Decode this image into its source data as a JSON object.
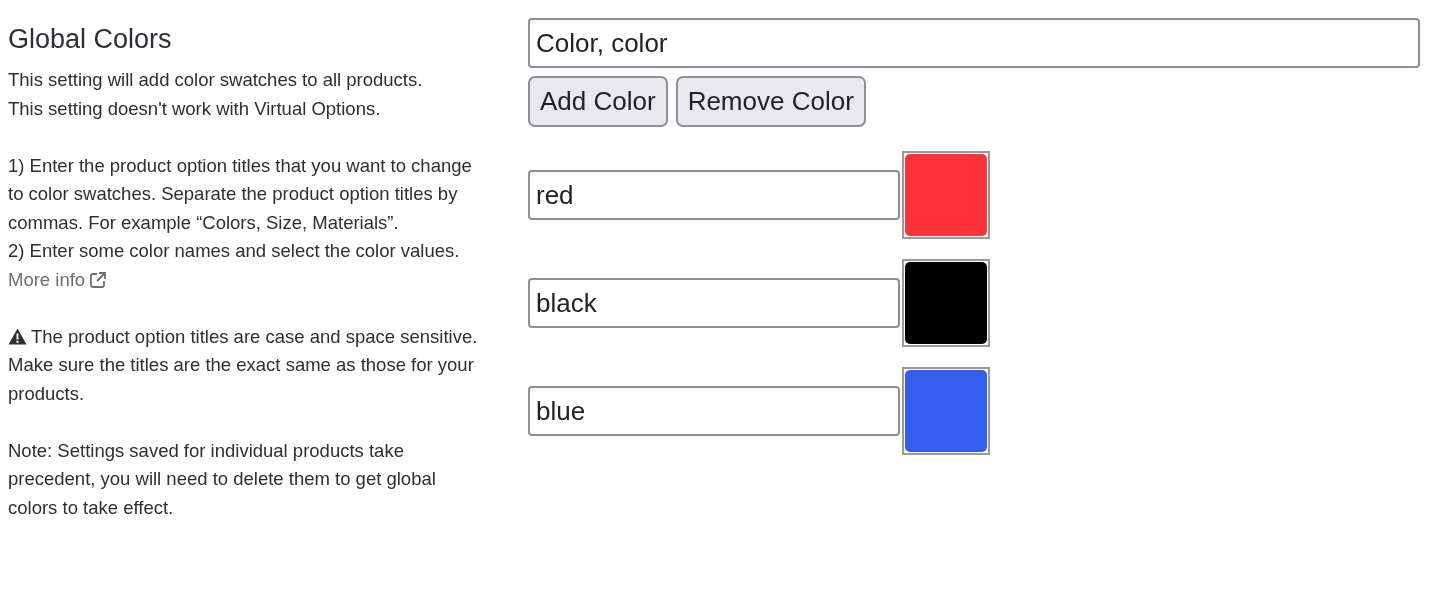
{
  "heading": "Global Colors",
  "intro_lines": [
    "This setting will add color swatches to all products.",
    "This setting doesn't work with Virtual Options."
  ],
  "steps": [
    "1) Enter the product option titles that you want to change to color swatches. Separate the product option titles by commas. For example “Colors, Size, Materials”.",
    "2) Enter some color names and select the color values."
  ],
  "more_info_link": "More info",
  "warning": "The product option titles are case and space sensitive. Make sure the titles are the exact same as those for your products.",
  "note": "Note: Settings saved for individual products take precedent, you will need to delete them to get global colors to take effect.",
  "option_titles_field": {
    "value": "Color, color"
  },
  "buttons": [
    "Add Color",
    "Remove Color"
  ],
  "colors": [
    {
      "name": "red",
      "color": "#fe333a"
    },
    {
      "name": "black",
      "color": "#000000"
    },
    {
      "name": "blue",
      "color": "#335eee"
    }
  ]
}
